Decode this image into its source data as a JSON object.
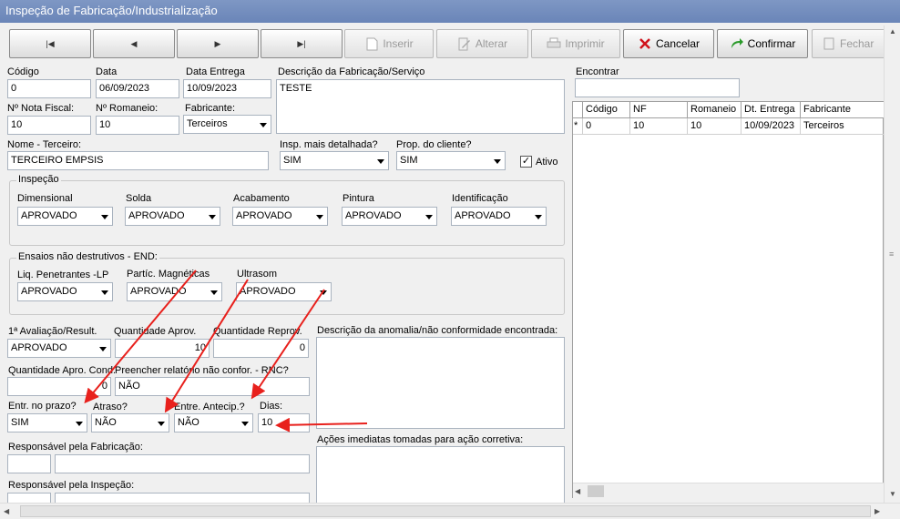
{
  "window": {
    "title": "Inspeção de Fabricação/Industrialização"
  },
  "toolbar": {
    "first": "|◀",
    "prev": "◀",
    "next": "▶",
    "last": "▶|",
    "inserir": "Inserir",
    "alterar": "Alterar",
    "imprimir": "Imprimir",
    "cancelar": "Cancelar",
    "confirmar": "Confirmar",
    "fechar": "Fechar"
  },
  "form": {
    "codigo": {
      "label": "Código",
      "value": "0"
    },
    "data": {
      "label": "Data",
      "value": "06/09/2023"
    },
    "data_entrega": {
      "label": "Data Entrega",
      "value": "10/09/2023"
    },
    "descricao": {
      "label": "Descrição da Fabricação/Serviço",
      "value": "TESTE"
    },
    "nota_fiscal": {
      "label": "Nº Nota Fiscal:",
      "value": "10"
    },
    "romaneio": {
      "label": "Nº Romaneio:",
      "value": "10"
    },
    "fabricante": {
      "label": "Fabricante:",
      "value": "Terceiros"
    },
    "nome_terceiro": {
      "label": "Nome - Terceiro:",
      "value": "TERCEIRO EMPSIS"
    },
    "insp_detalhada": {
      "label": "Insp. mais detalhada?",
      "value": "SIM"
    },
    "prop_cliente": {
      "label": "Prop. do cliente?",
      "value": "SIM"
    },
    "ativo": {
      "label": "Ativo",
      "checked": "✓"
    },
    "inspecao": {
      "title": "Inspeção",
      "dimensional": {
        "label": "Dimensional",
        "value": "APROVADO"
      },
      "solda": {
        "label": "Solda",
        "value": "APROVADO"
      },
      "acabamento": {
        "label": "Acabamento",
        "value": "APROVADO"
      },
      "pintura": {
        "label": "Pintura",
        "value": "APROVADO"
      },
      "identificacao": {
        "label": "Identificação",
        "value": "APROVADO"
      }
    },
    "end": {
      "title": "Ensaios não destrutivos - END:",
      "liq": {
        "label": "Liq. Penetrantes -LP",
        "value": "APROVADO"
      },
      "particulas": {
        "label": "Partíc. Magnéticas",
        "value": "APROVADO"
      },
      "ultrasom": {
        "label": "Ultrasom",
        "value": "APROVADO"
      }
    },
    "avaliacao": {
      "label": "1ª Avaliação/Result.",
      "value": "APROVADO"
    },
    "qtd_aprov": {
      "label": "Quantidade Aprov.",
      "value": "10"
    },
    "qtd_reprov": {
      "label": "Quantidade Reprov.",
      "value": "0"
    },
    "anomalia": {
      "label": "Descrição da anomalia/não conformidade encontrada:"
    },
    "qtd_apro_cond": {
      "label": "Quantidade Apro. Cond.",
      "value": "0"
    },
    "rnc": {
      "label": "Preencher relatório não confor. - RNC?",
      "value": "NÃO"
    },
    "entr_prazo": {
      "label": "Entr. no prazo?",
      "value": "SIM"
    },
    "atraso": {
      "label": "Atraso?",
      "value": "NÃO"
    },
    "entr_antecip": {
      "label": "Entre. Antecip.?",
      "value": "NÃO"
    },
    "dias": {
      "label": "Dias:",
      "value": "10"
    },
    "acoes": {
      "label": "Ações imediatas tomadas para ação corretiva:"
    },
    "resp_fabricacao": {
      "label": "Responsável pela Fabricação:"
    },
    "resp_inspecao": {
      "label": "Responsável pela Inspeção:"
    }
  },
  "search": {
    "label": "Encontrar",
    "value": ""
  },
  "table": {
    "columns": [
      "Código",
      "NF",
      "Romaneio",
      "Dt. Entrega",
      "Fabricante"
    ],
    "rows": [
      {
        "marker": "*",
        "codigo": "0",
        "nf": "10",
        "romaneio": "10",
        "dt_entrega": "10/09/2023",
        "fabricante": "Terceiros"
      }
    ]
  },
  "colors": {
    "titlebar": "#6a85b8",
    "annotation_arrow": "#e8201c"
  }
}
